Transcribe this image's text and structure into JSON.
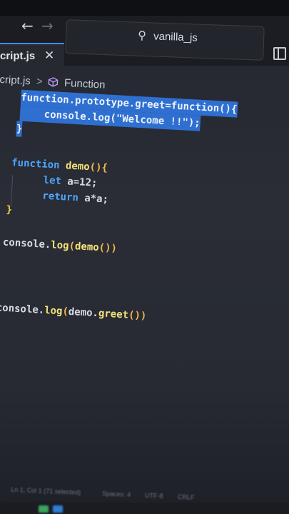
{
  "window": {
    "search_text": "vanilla_js",
    "nav_back_icon": "arrow-left-icon",
    "nav_forward_icon": "arrow-right-icon",
    "search_icon": "search-icon",
    "layout_icon": "toggle-sidebar-icon"
  },
  "tab": {
    "label": "cript.js",
    "close_icon": "close-icon"
  },
  "breadcrumb": {
    "file": "cript.js",
    "separator": ">",
    "symbol": "Function",
    "symbol_icon": "cube-icon"
  },
  "editor": {
    "selection_color": "#2f6fd0",
    "lines": [
      {
        "tokens": [
          [
            "kw",
            "function"
          ],
          [
            "plain",
            "."
          ],
          [
            "plain",
            "prototype"
          ],
          [
            "plain",
            "."
          ],
          [
            "fn",
            "greet"
          ],
          [
            "plain",
            "="
          ],
          [
            "kw",
            "function"
          ],
          [
            "paren",
            "(){"
          ]
        ]
      },
      {
        "tokens": [
          [
            "plain",
            "    console"
          ],
          [
            "plain",
            "."
          ],
          [
            "fn",
            "log"
          ],
          [
            "paren",
            "("
          ],
          [
            "str",
            "\"Welcome !!\""
          ],
          [
            "paren",
            ")"
          ],
          [
            "plain",
            ";"
          ]
        ]
      },
      {
        "tokens": [
          [
            "brace-y",
            "}"
          ]
        ]
      },
      {
        "tokens": [
          [
            "kw",
            "function"
          ],
          [
            "plain",
            " "
          ],
          [
            "fn",
            "demo"
          ],
          [
            "paren",
            "(){"
          ]
        ]
      },
      {
        "tokens": [
          [
            "kw",
            "    let"
          ],
          [
            "plain",
            " a=12;"
          ]
        ]
      },
      {
        "tokens": [
          [
            "kw",
            "    return"
          ],
          [
            "plain",
            " a*a;"
          ]
        ]
      },
      {
        "tokens": [
          [
            "brace-y",
            "}"
          ]
        ]
      },
      {
        "tokens": [
          [
            "plain",
            "console."
          ],
          [
            "fn",
            "log"
          ],
          [
            "paren",
            "("
          ],
          [
            "fn",
            "demo"
          ],
          [
            "paren",
            "())"
          ]
        ]
      },
      {
        "tokens": [
          [
            "plain",
            "console."
          ],
          [
            "fn",
            "log"
          ],
          [
            "paren",
            "("
          ],
          [
            "plain",
            "demo."
          ],
          [
            "fn",
            "greet"
          ],
          [
            "paren",
            "())"
          ]
        ]
      }
    ]
  },
  "statusbar": {
    "position": "Ln 1, Col 1 (71 selected)",
    "spaces": "Spaces: 4",
    "encoding": "UTF-8",
    "eol": "CRLF"
  },
  "colors": {
    "keyword": "#4da6ff",
    "function_name": "#f2e27a",
    "bracket": "#f1b64a",
    "tab_accent": "#3c8ef0"
  }
}
